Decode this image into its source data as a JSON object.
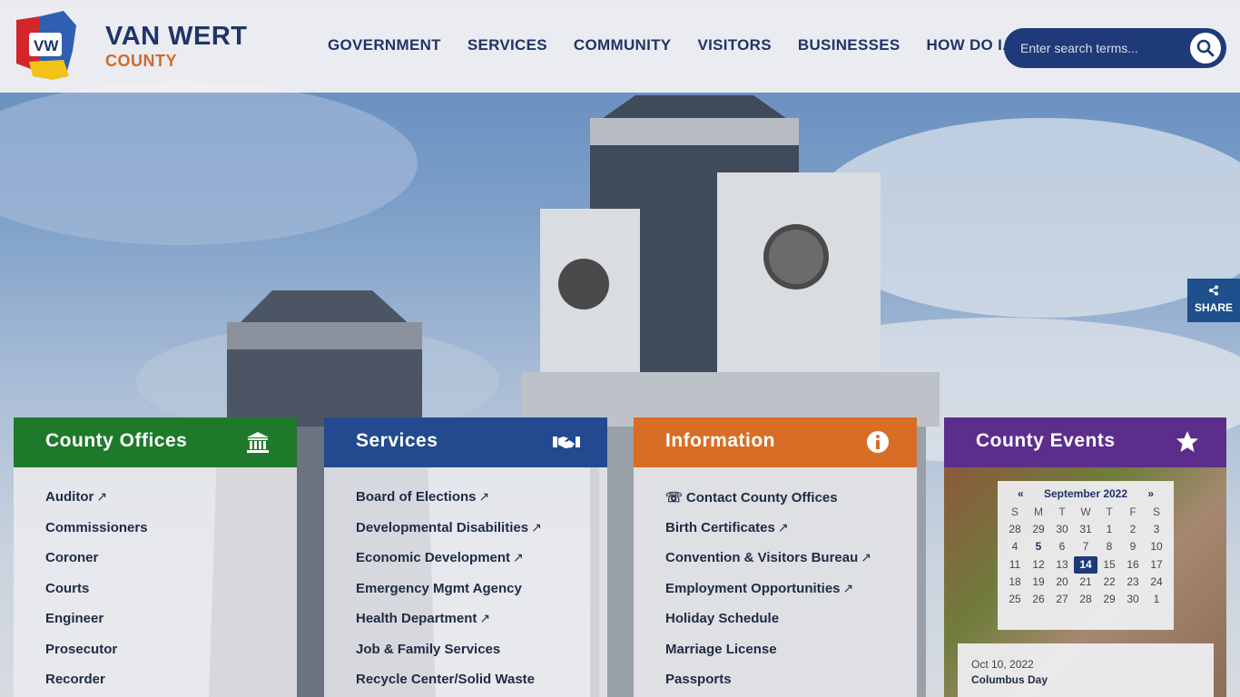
{
  "header": {
    "title": "VAN WERT",
    "subtitle": "COUNTY",
    "logo_text": "VW",
    "nav": [
      "GOVERNMENT",
      "SERVICES",
      "COMMUNITY",
      "VISITORS",
      "BUSINESSES",
      "HOW DO I...?"
    ],
    "search_placeholder": "Enter search terms...",
    "search_icon": "search-icon"
  },
  "share": {
    "label": "SHARE",
    "icon": "share-icon"
  },
  "panels": {
    "county_offices": {
      "title": "County Offices",
      "icon": "building-columns-icon",
      "color": "#1e7a2a",
      "items": [
        {
          "label": "Auditor",
          "external": "↗"
        },
        {
          "label": "Commissioners"
        },
        {
          "label": "Coroner"
        },
        {
          "label": "Courts"
        },
        {
          "label": "Engineer"
        },
        {
          "label": "Prosecutor"
        },
        {
          "label": "Recorder"
        }
      ]
    },
    "services": {
      "title": "Services",
      "icon": "handshake-icon",
      "color": "#234a8e",
      "items": [
        {
          "label": "Board of Elections",
          "external": "↗"
        },
        {
          "label": "Developmental Disabilities",
          "external": "↗"
        },
        {
          "label": "Economic Development",
          "external": "↗"
        },
        {
          "label": "Emergency Mgmt Agency"
        },
        {
          "label": "Health Department",
          "external": "↗"
        },
        {
          "label": "Job & Family Services"
        },
        {
          "label": "Recycle Center/Solid Waste"
        }
      ]
    },
    "information": {
      "title": "Information",
      "icon": "info-circle-icon",
      "color": "#d86d26",
      "items": [
        {
          "label": "☏ Contact County Offices"
        },
        {
          "label": "Birth Certificates",
          "external": "↗"
        },
        {
          "label": "Convention & Visitors Bureau",
          "external": "↗"
        },
        {
          "label": "Employment Opportunities",
          "external": "↗"
        },
        {
          "label": "Holiday Schedule"
        },
        {
          "label": "Marriage License"
        },
        {
          "label": "Passports"
        }
      ]
    },
    "events": {
      "title": "County Events",
      "icon": "star-icon",
      "color": "#5d2d8c",
      "calendar": {
        "prev": "«",
        "month": "September 2022",
        "next": "»",
        "days_of_week": [
          "S",
          "M",
          "T",
          "W",
          "T",
          "F",
          "S"
        ],
        "cells": [
          "28",
          "29",
          "30",
          "31",
          "1",
          "2",
          "3",
          "4",
          "5",
          "6",
          "7",
          "8",
          "9",
          "10",
          "11",
          "12",
          "13",
          "14",
          "15",
          "16",
          "17",
          "18",
          "19",
          "20",
          "21",
          "22",
          "23",
          "24",
          "25",
          "26",
          "27",
          "28",
          "29",
          "30",
          "1"
        ],
        "highlight": "5",
        "today": "14"
      },
      "event": {
        "date": "Oct 10, 2022",
        "name": "Columbus Day"
      }
    }
  }
}
